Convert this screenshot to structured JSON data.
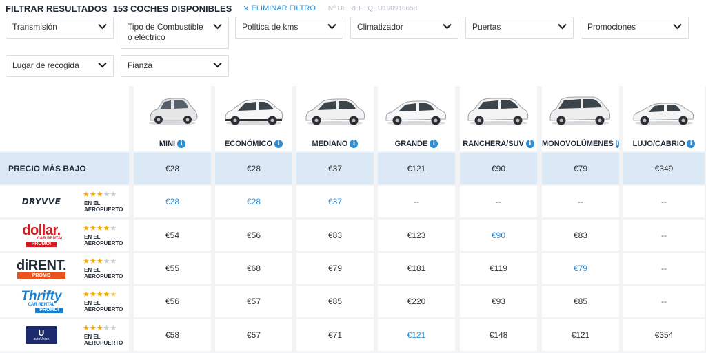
{
  "header": {
    "title": "FILTRAR RESULTADOS",
    "count": "153 COCHES DISPONIBLES",
    "clear_filter": "ELIMINAR FILTRO",
    "ref": "Nº DE REF.: QEU190916658"
  },
  "filters": [
    {
      "label": "Transmisión"
    },
    {
      "label": "Tipo de Combustible o eléctrico"
    },
    {
      "label": "Política de kms"
    },
    {
      "label": "Climatizador"
    },
    {
      "label": "Puertas"
    },
    {
      "label": "Promociones"
    },
    {
      "label": "Lugar de recogida"
    },
    {
      "label": "Fianza"
    }
  ],
  "categories": [
    {
      "name": "MINI",
      "car_color": "#e8e8e8"
    },
    {
      "name": "ECONÓMICO",
      "car_color": "#f4f4f4"
    },
    {
      "name": "MEDIANO",
      "car_color": "#f0f0f0"
    },
    {
      "name": "GRANDE",
      "car_color": "#f6f6f6"
    },
    {
      "name": "RANCHERA/SUV",
      "car_color": "#f2f2f2"
    },
    {
      "name": "MONOVOLÚMENES",
      "car_color": "#eeeeee"
    },
    {
      "name": "LUJO/CABRIO",
      "car_color": "#f4f4f4"
    }
  ],
  "lowest_price": {
    "label": "PRECIO MÁS BAJO",
    "prices": [
      "€28",
      "€28",
      "€37",
      "€121",
      "€90",
      "€79",
      "€349"
    ]
  },
  "suppliers": [
    {
      "name": "DRYVVE",
      "rating": 3,
      "location": "EN EL AEROPUERTO",
      "prices": [
        "€28",
        "€28",
        "€37",
        "--",
        "--",
        "--",
        "--"
      ],
      "highlight": [
        true,
        true,
        true,
        false,
        false,
        false,
        false
      ]
    },
    {
      "name": "dollar.",
      "sub": "CAR RENTAL",
      "promo": "PROMO!",
      "rating": 4,
      "location": "EN EL AEROPUERTO",
      "prices": [
        "€54",
        "€56",
        "€83",
        "€123",
        "€90",
        "€83",
        "--"
      ],
      "highlight": [
        false,
        false,
        false,
        false,
        true,
        false,
        false
      ]
    },
    {
      "name": "diRENT.",
      "promo": "PROMO",
      "rating": 3,
      "location": "EN EL AEROPUERTO",
      "prices": [
        "€55",
        "€68",
        "€79",
        "€181",
        "€119",
        "€79",
        "--"
      ],
      "highlight": [
        false,
        false,
        false,
        false,
        false,
        true,
        false
      ]
    },
    {
      "name": "Thrifty",
      "sub": "CAR RENTAL",
      "promo": "PROMO!",
      "rating": 4.5,
      "location": "EN EL AEROPUERTO",
      "prices": [
        "€56",
        "€57",
        "€85",
        "€220",
        "€93",
        "€85",
        "--"
      ],
      "highlight": [
        false,
        false,
        false,
        false,
        false,
        false,
        false
      ]
    },
    {
      "name": "autoUnion",
      "rating": 3,
      "location": "EN EL AEROPUERTO",
      "prices": [
        "€58",
        "€57",
        "€71",
        "€121",
        "€148",
        "€121",
        "€354"
      ],
      "highlight": [
        false,
        false,
        false,
        true,
        false,
        false,
        false
      ]
    }
  ]
}
